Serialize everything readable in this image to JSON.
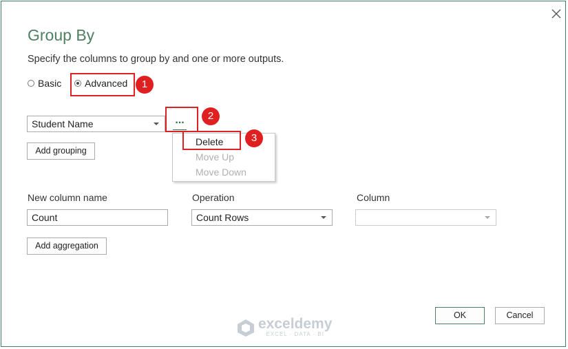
{
  "dialog": {
    "title": "Group By",
    "subtitle": "Specify the columns to group by and one or more outputs."
  },
  "mode": {
    "basic_label": "Basic",
    "advanced_label": "Advanced",
    "selected": "Advanced"
  },
  "grouping": {
    "column_value": "Student Name",
    "more_options_label": "...",
    "add_button": "Add grouping"
  },
  "context_menu": {
    "items": [
      {
        "label": "Delete",
        "enabled": true
      },
      {
        "label": "Move Up",
        "enabled": false
      },
      {
        "label": "Move Down",
        "enabled": false
      }
    ]
  },
  "aggregation": {
    "new_column_label": "New column name",
    "new_column_value": "Count",
    "operation_label": "Operation",
    "operation_value": "Count Rows",
    "column_label": "Column",
    "column_value": "",
    "add_button": "Add aggregation"
  },
  "footer": {
    "ok_label": "OK",
    "cancel_label": "Cancel"
  },
  "annotations": {
    "badge_1": "1",
    "badge_2": "2",
    "badge_3": "3",
    "color": "#e02020"
  },
  "watermark": {
    "name": "exceldemy",
    "tagline": "EXCEL · DATA · BI"
  },
  "colors": {
    "accent": "#4f7f63",
    "dialog_border": "#3f7f5f"
  }
}
